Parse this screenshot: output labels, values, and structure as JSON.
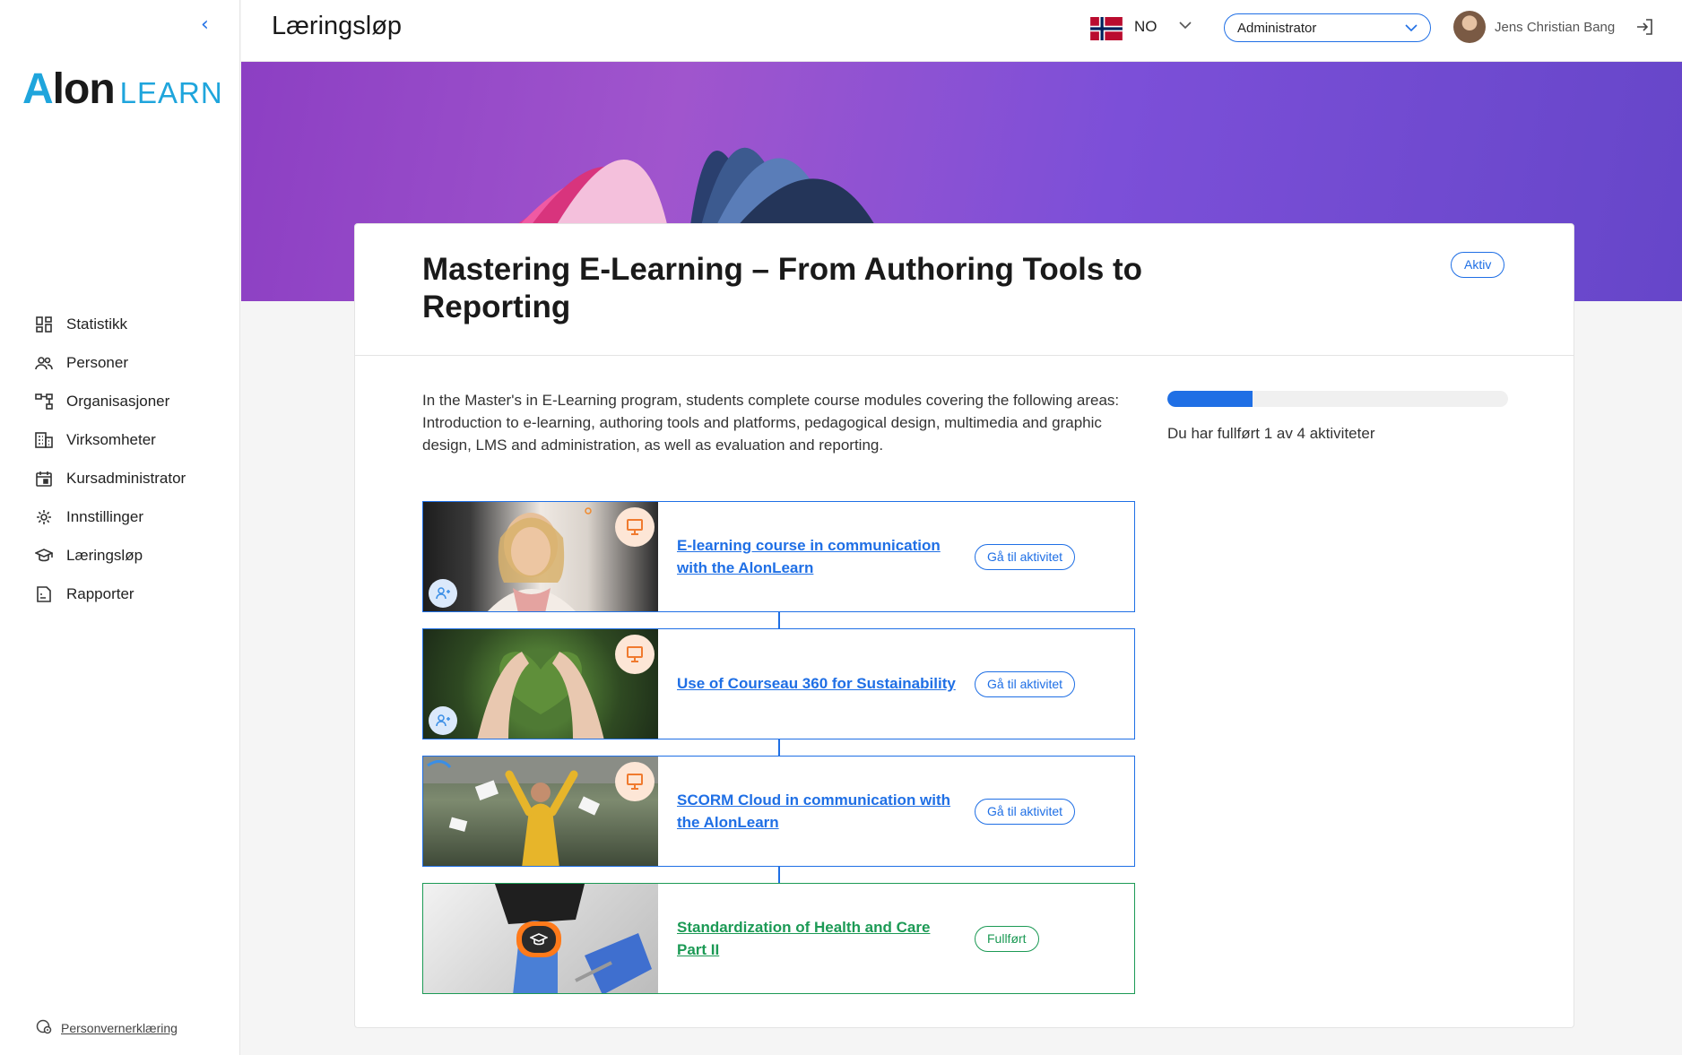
{
  "sidebar": {
    "logo_main": "Alon",
    "logo_sub": "LEARN",
    "items": [
      {
        "label": "Statistikk",
        "icon": "dashboard-icon"
      },
      {
        "label": "Personer",
        "icon": "people-icon"
      },
      {
        "label": "Organisasjoner",
        "icon": "org-chart-icon"
      },
      {
        "label": "Virksomheter",
        "icon": "building-icon"
      },
      {
        "label": "Kursadministrator",
        "icon": "calendar-icon"
      },
      {
        "label": "Innstillinger",
        "icon": "gear-icon"
      },
      {
        "label": "Læringsløp",
        "icon": "graduation-cap-icon"
      },
      {
        "label": "Rapporter",
        "icon": "report-icon"
      }
    ],
    "privacy_label": "Personvernerklæring"
  },
  "header": {
    "title": "Læringsløp",
    "language": "NO",
    "role": "Administrator",
    "user_name": "Jens Christian Bang"
  },
  "course": {
    "title": "Mastering E-Learning – From Authoring Tools to Reporting",
    "status": "Aktiv",
    "description": "In the Master's in E-Learning program, students complete course modules covering the following areas: Introduction to e-learning, authoring tools and platforms, pedagogical design, multimedia and graphic design, LMS and administration, as well as evaluation and reporting.",
    "progress_completed": 1,
    "progress_total": 4,
    "progress_text": "Du har fullført 1 av 4 aktiviteter"
  },
  "activities": [
    {
      "title": "E-learning course in communication with the AlonLearn",
      "button": "Gå til aktivitet",
      "state": "open"
    },
    {
      "title": "Use of Courseau 360 for Sustainability",
      "button": "Gå til aktivitet",
      "state": "open"
    },
    {
      "title": "SCORM Cloud in communication with the AlonLearn",
      "button": "Gå til aktivitet",
      "state": "open"
    },
    {
      "title": "Standardization of Health and Care Part II",
      "button": "Fullført",
      "state": "done"
    }
  ],
  "colors": {
    "accent": "#1f6fe5",
    "success": "#1c9a55",
    "logo_blue": "#1fa5dc"
  }
}
